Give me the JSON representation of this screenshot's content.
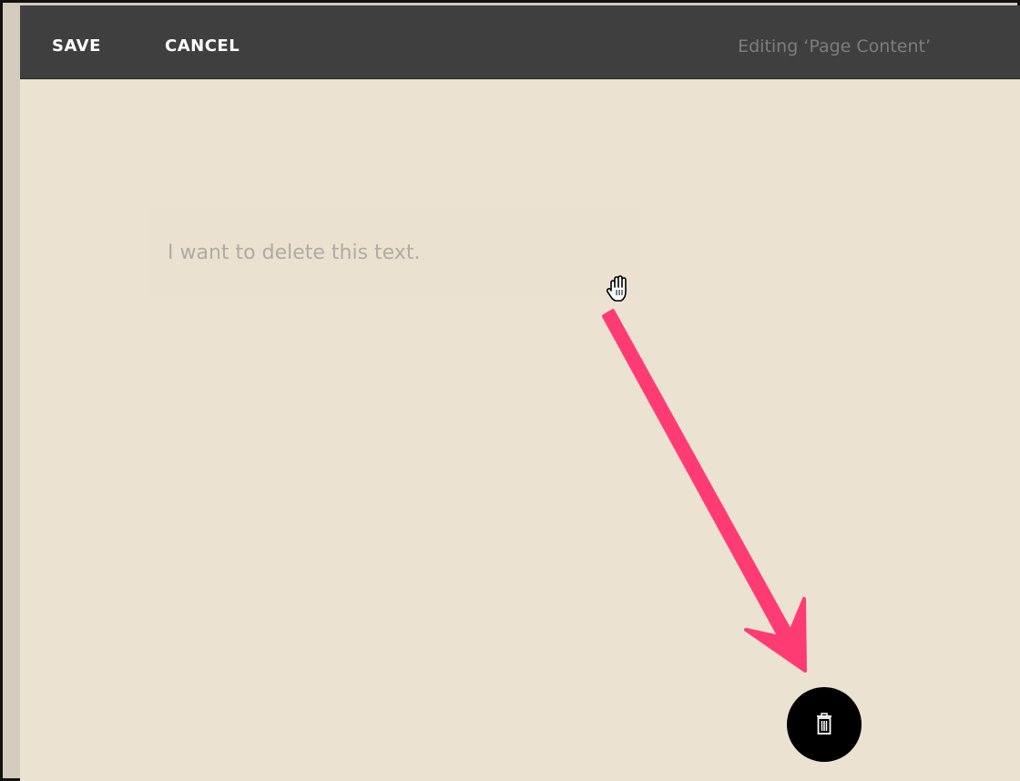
{
  "toolbar": {
    "save_label": "SAVE",
    "cancel_label": "CANCEL",
    "editing_label": "Editing ‘Page Content’"
  },
  "content": {
    "text_block": "I want to delete this text."
  },
  "icons": {
    "cursor": "hand-cursor-icon",
    "delete": "trash-icon",
    "annotation": "arrow-annotation"
  },
  "colors": {
    "toolbar_bg": "#3f3f3f",
    "canvas_bg": "#ece2d2",
    "arrow": "#ff3b74",
    "trash_button": "#000000"
  }
}
